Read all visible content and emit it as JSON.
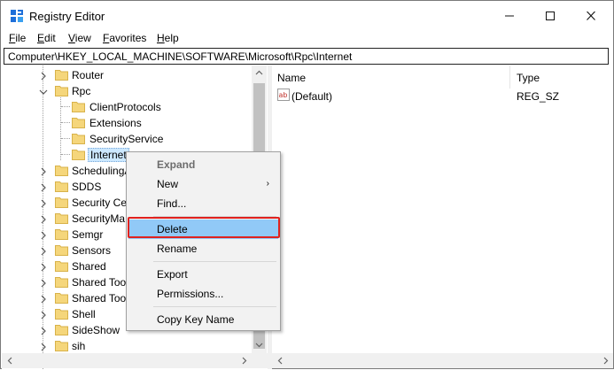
{
  "window": {
    "title": "Registry Editor",
    "controls": {
      "minimize": "—",
      "maximize": "☐",
      "close": "✕"
    }
  },
  "menu": {
    "items": [
      {
        "label": "File"
      },
      {
        "label": "Edit"
      },
      {
        "label": "View"
      },
      {
        "label": "Favorites"
      },
      {
        "label": "Help"
      }
    ]
  },
  "address": {
    "path": "Computer\\HKEY_LOCAL_MACHINE\\SOFTWARE\\Microsoft\\Rpc\\Internet"
  },
  "tree": {
    "items": [
      {
        "label": "Router",
        "level": 0,
        "expander": "collapsed"
      },
      {
        "label": "Rpc",
        "level": 0,
        "expander": "expanded"
      },
      {
        "label": "ClientProtocols",
        "level": 1,
        "expander": "none"
      },
      {
        "label": "Extensions",
        "level": 1,
        "expander": "none"
      },
      {
        "label": "SecurityService",
        "level": 1,
        "expander": "none"
      },
      {
        "label": "Internet",
        "level": 1,
        "expander": "none",
        "selected": true
      },
      {
        "label": "SchedulingA",
        "level": 0,
        "expander": "collapsed"
      },
      {
        "label": "SDDS",
        "level": 0,
        "expander": "collapsed"
      },
      {
        "label": "Security Ce",
        "level": 0,
        "expander": "collapsed"
      },
      {
        "label": "SecurityMa",
        "level": 0,
        "expander": "collapsed"
      },
      {
        "label": "Semgr",
        "level": 0,
        "expander": "collapsed"
      },
      {
        "label": "Sensors",
        "level": 0,
        "expander": "collapsed"
      },
      {
        "label": "Shared",
        "level": 0,
        "expander": "collapsed"
      },
      {
        "label": "Shared Too",
        "level": 0,
        "expander": "collapsed"
      },
      {
        "label": "Shared Too",
        "level": 0,
        "expander": "collapsed"
      },
      {
        "label": "Shell",
        "level": 0,
        "expander": "collapsed"
      },
      {
        "label": "SideShow",
        "level": 0,
        "expander": "collapsed"
      },
      {
        "label": "sih",
        "level": 0,
        "expander": "collapsed"
      }
    ]
  },
  "list": {
    "columns": [
      {
        "label": "Name"
      },
      {
        "label": "Type"
      }
    ],
    "rows": [
      {
        "name": "(Default)",
        "type": "REG_SZ",
        "icon": "string-value-icon"
      }
    ]
  },
  "context_menu": {
    "items": [
      {
        "label": "Expand",
        "disabled": true
      },
      {
        "label": "New",
        "submenu": true
      },
      {
        "label": "Find..."
      },
      {
        "separator": true
      },
      {
        "label": "Delete",
        "highlighted": true
      },
      {
        "label": "Rename"
      },
      {
        "separator": true
      },
      {
        "label": "Export"
      },
      {
        "label": "Permissions..."
      },
      {
        "separator": true
      },
      {
        "label": "Copy Key Name"
      }
    ],
    "submenu_arrow": "›"
  },
  "colors": {
    "selection": "#cce8ff",
    "menu_highlight": "#91c9f7",
    "annotation_border": "#e0221f",
    "folder": "#f5d67b"
  }
}
